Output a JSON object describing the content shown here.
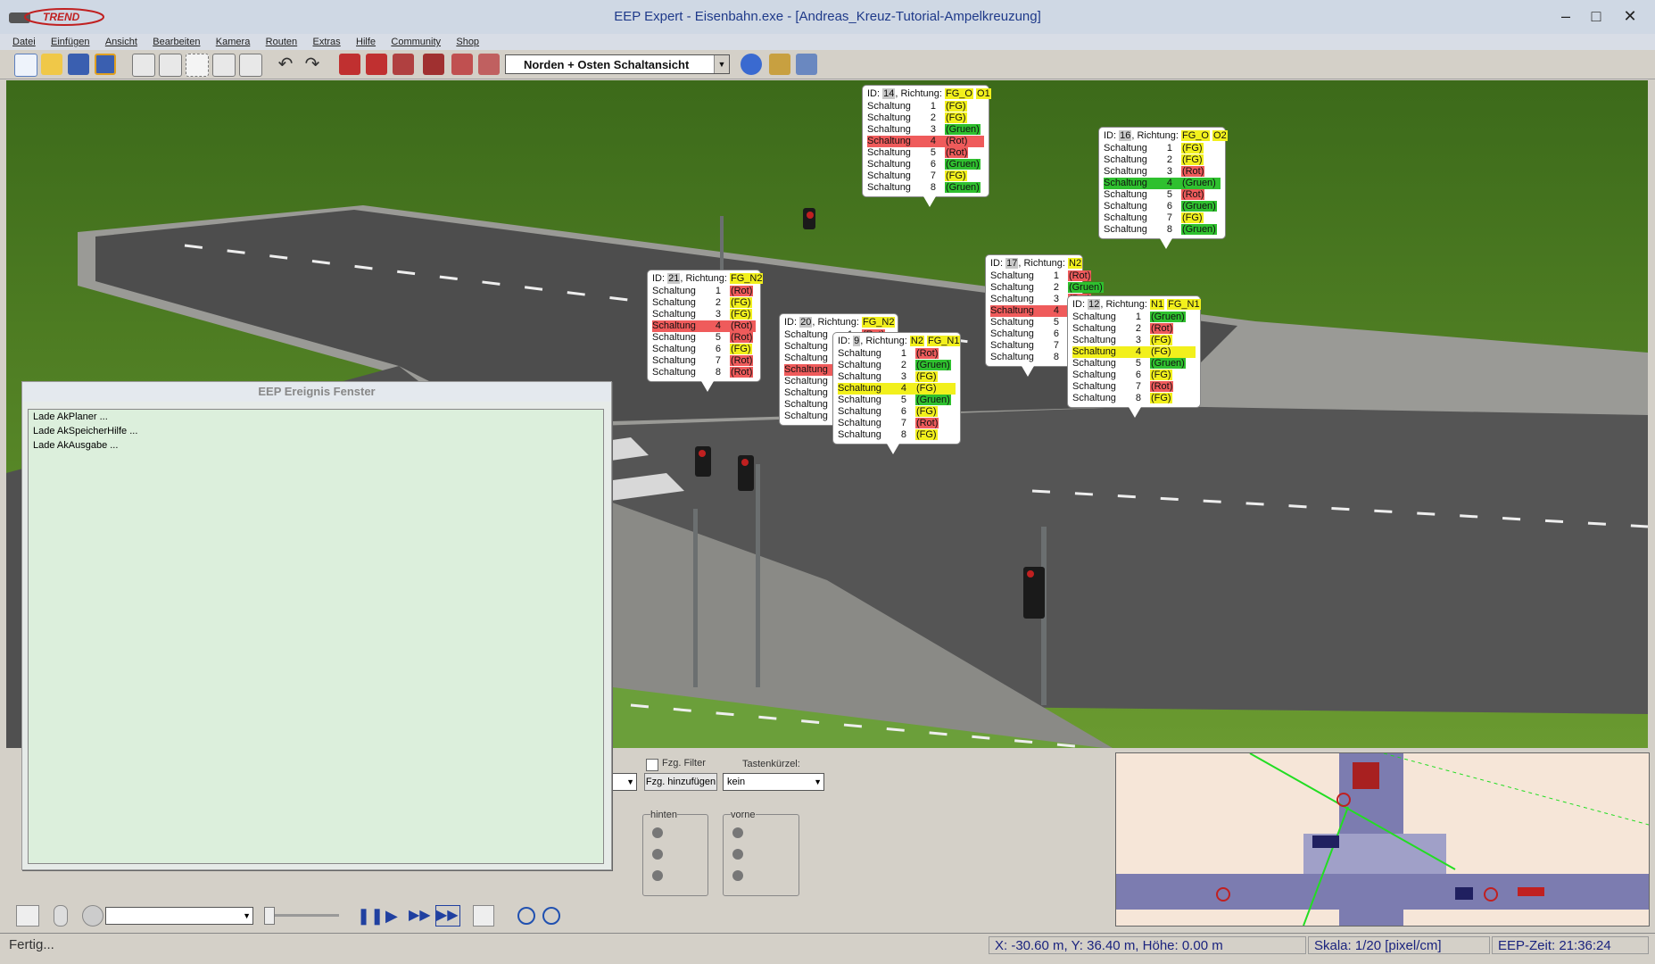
{
  "window": {
    "title": "EEP Expert - Eisenbahn.exe - [Andreas_Kreuz-Tutorial-Ampelkreuzung]",
    "logo_text": "TREND",
    "controls": [
      "–",
      "□",
      "✕"
    ]
  },
  "menu": [
    "Datei",
    "Einfügen",
    "Ansicht",
    "Bearbeiten",
    "Kamera",
    "Routen",
    "Extras",
    "Hilfe",
    "Community",
    "Shop"
  ],
  "toolbar": {
    "view_select": "Norden + Osten Schaltansicht",
    "icons": [
      "new-file-icon",
      "open-folder-icon",
      "save-icon",
      "save-as-icon",
      "copy-icon",
      "paste-icon",
      "select-icon",
      "duplicate-icon",
      "move-icon",
      "undo-icon",
      "redo-icon",
      "track-icon-1",
      "track-icon-2",
      "track-icon-3",
      "track-icon-4",
      "track-icon-5",
      "track-icon-6",
      "weather-icon",
      "tools-icon",
      "lua-icon"
    ]
  },
  "bubbles": [
    {
      "id": "14",
      "dir": "FG_O",
      "dir2": "O1",
      "rows": [
        [
          "1",
          "FG",
          "y"
        ],
        [
          "2",
          "FG",
          "y"
        ],
        [
          "3",
          "Gruen",
          "g"
        ],
        [
          "4",
          "Rot",
          "r",
          true
        ],
        [
          "5",
          "Rot",
          "r"
        ],
        [
          "6",
          "Gruen",
          "g"
        ],
        [
          "7",
          "FG",
          "y"
        ],
        [
          "8",
          "Gruen",
          "g"
        ]
      ]
    },
    {
      "id": "16",
      "dir": "FG_O",
      "dir2": "O2",
      "rows": [
        [
          "1",
          "FG",
          "y"
        ],
        [
          "2",
          "FG",
          "y"
        ],
        [
          "3",
          "Rot",
          "r"
        ],
        [
          "4",
          "Gruen",
          "g",
          true
        ],
        [
          "5",
          "Rot",
          "r"
        ],
        [
          "6",
          "Gruen",
          "g"
        ],
        [
          "7",
          "FG",
          "y"
        ],
        [
          "8",
          "Gruen",
          "g"
        ]
      ]
    },
    {
      "id": "17",
      "dir": "N2",
      "dir2": "",
      "rows": [
        [
          "1",
          "Rot",
          "r"
        ],
        [
          "2",
          "Gruen",
          "g"
        ],
        [
          "3",
          "Rot",
          "r"
        ],
        [
          "4",
          "Rot",
          "r",
          true
        ],
        [
          "5",
          "Gruen",
          "g"
        ],
        [
          "6",
          "Rot",
          "r"
        ],
        [
          "7",
          "Rot",
          "r"
        ],
        [
          "8",
          "Rot",
          "r"
        ]
      ]
    },
    {
      "id": "12",
      "dir": "N1",
      "dir2": "FG_N1",
      "rows": [
        [
          "1",
          "Gruen",
          "g"
        ],
        [
          "2",
          "Rot",
          "r"
        ],
        [
          "3",
          "FG",
          "y"
        ],
        [
          "4",
          "FG",
          "y",
          true
        ],
        [
          "5",
          "Gruen",
          "g"
        ],
        [
          "6",
          "FG",
          "y"
        ],
        [
          "7",
          "Rot",
          "r"
        ],
        [
          "8",
          "FG",
          "y"
        ]
      ]
    },
    {
      "id": "21",
      "dir": "FG_N2",
      "dir2": "",
      "rows": [
        [
          "1",
          "Rot",
          "r"
        ],
        [
          "2",
          "FG",
          "y"
        ],
        [
          "3",
          "FG",
          "y"
        ],
        [
          "4",
          "Rot",
          "r",
          true
        ],
        [
          "5",
          "Rot",
          "r"
        ],
        [
          "6",
          "FG",
          "y"
        ],
        [
          "7",
          "Rot",
          "r"
        ],
        [
          "8",
          "Rot",
          "r"
        ]
      ]
    },
    {
      "id": "20",
      "dir": "FG_N2",
      "dir2": "",
      "rows": [
        [
          "1",
          "Rot",
          "r"
        ],
        [
          "2",
          "Rot",
          "r"
        ],
        [
          "3",
          "Rot",
          "r"
        ],
        [
          "4",
          "Rot",
          "r",
          true
        ],
        [
          "5",
          "Rot",
          "r"
        ],
        [
          "6",
          "Rot",
          "r"
        ],
        [
          "7",
          "Rot",
          "r"
        ],
        [
          "8",
          "Rot",
          "r"
        ]
      ]
    },
    {
      "id": "9",
      "dir": "N2",
      "dir2": "FG_N1",
      "rows": [
        [
          "1",
          "Rot",
          "r"
        ],
        [
          "2",
          "Gruen",
          "g"
        ],
        [
          "3",
          "FG",
          "y"
        ],
        [
          "4",
          "FG",
          "y",
          true
        ],
        [
          "5",
          "Gruen",
          "g"
        ],
        [
          "6",
          "FG",
          "y"
        ],
        [
          "7",
          "Rot",
          "r"
        ],
        [
          "8",
          "FG",
          "y"
        ]
      ]
    }
  ],
  "labels": {
    "id": "ID:",
    "richtung": "Richtung:",
    "schaltung": "Schaltung"
  },
  "event_window": {
    "title": "EEP Ereignis Fenster",
    "lines": [
      "Lade AkPlaner ...",
      "Lade AkSpeicherHilfe ...",
      "Lade AkAusgabe ..."
    ]
  },
  "bottom_panel": {
    "fzg_filter": "Fzg. Filter",
    "tastenkuerzel": "Tastenkürzel:",
    "add_button": "Fzg. hinzufügen",
    "shortcut_value": "kein",
    "hinten": "hinten",
    "vorne": "vorne"
  },
  "status": {
    "left": "Fertig...",
    "coords": "X: -30.60 m, Y: 36.40 m, Höhe: 0.00 m",
    "scale": "Skala: 1/20 [pixel/cm]",
    "time": "EEP-Zeit: 21:36:24"
  },
  "colors": {
    "yellow": "#f2f01c",
    "red": "#ef5b5b",
    "green": "#2fc02f",
    "accent": "#1f3a8a"
  }
}
